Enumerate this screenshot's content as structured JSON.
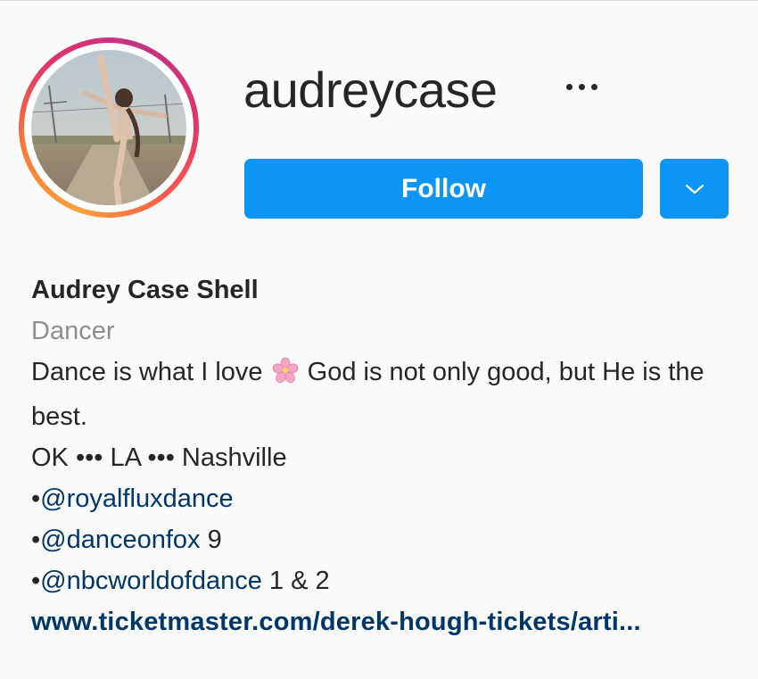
{
  "profile": {
    "username": "audreycase",
    "full_name": "Audrey Case Shell",
    "category": "Dancer",
    "bio_text_before_emoji": "Dance is what I love ",
    "bio_emoji": "cherry-blossom-emoji",
    "bio_text_after_emoji": " God is not only good, but He is the best.",
    "locations": "OK ••• LA ••• Nashville",
    "mentions": [
      {
        "bullet": "•",
        "handle": "@royalfluxdance",
        "suffix": ""
      },
      {
        "bullet": "•",
        "handle": "@danceonfox",
        "suffix": " 9"
      },
      {
        "bullet": "•",
        "handle": "@nbcworldofdance",
        "suffix": " 1 & 2"
      }
    ],
    "website": "www.ticketmaster.com/derek-hough-tickets/arti..."
  },
  "actions": {
    "follow_label": "Follow",
    "more_icon": "ellipsis-icon",
    "dropdown_icon": "chevron-down-icon"
  },
  "colors": {
    "primary_button": "#0d95f6",
    "link": "#00376b",
    "secondary_text": "#8e8e8e",
    "ring_start": "#f9a23a",
    "ring_end": "#c13584"
  }
}
